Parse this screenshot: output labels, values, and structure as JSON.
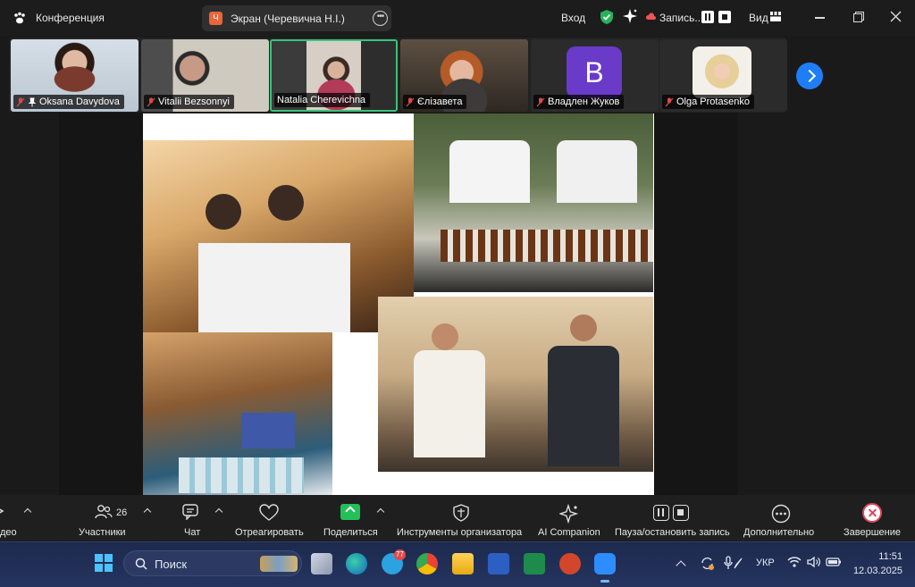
{
  "topbar": {
    "app_title": "Конференция",
    "screen_badge": "Ч",
    "screen_label": "Экран (Черевична Н.І.)",
    "enter_label": "Вход",
    "record_label": "Запись...",
    "view_label": "Вид"
  },
  "participants": [
    {
      "name": "Oksana Davydova"
    },
    {
      "name": "Vitalii Bezsonnyi"
    },
    {
      "name": "Natalia Cherevichna"
    },
    {
      "name": "Єлізавета"
    },
    {
      "name": "Владлен Жуков",
      "avatar_letter": "B"
    },
    {
      "name": "Olga Protasenko"
    }
  ],
  "toolbar": {
    "video_label": "део",
    "participants_label": "Участники",
    "participants_count": "26",
    "chat_label": "Чат",
    "react_label": "Отреагировать",
    "share_label": "Поделиться",
    "host_tools_label": "Инструменты организатора",
    "ai_label": "AI Companion",
    "pause_rec_label": "Пауза/остановить запись",
    "more_label": "Дополнительно",
    "end_label": "Завершение"
  },
  "taskbar": {
    "search_text": "Поиск",
    "telegram_badge": "77",
    "lang": "УКР",
    "time": "11:51",
    "date": "12.03.2025"
  },
  "colors": {
    "accent_green": "#36c57a",
    "share_green": "#23c05a",
    "zoom_blue": "#1f7ef6",
    "end_red": "#e0455e",
    "avatar_purple": "#6a3ac9"
  }
}
